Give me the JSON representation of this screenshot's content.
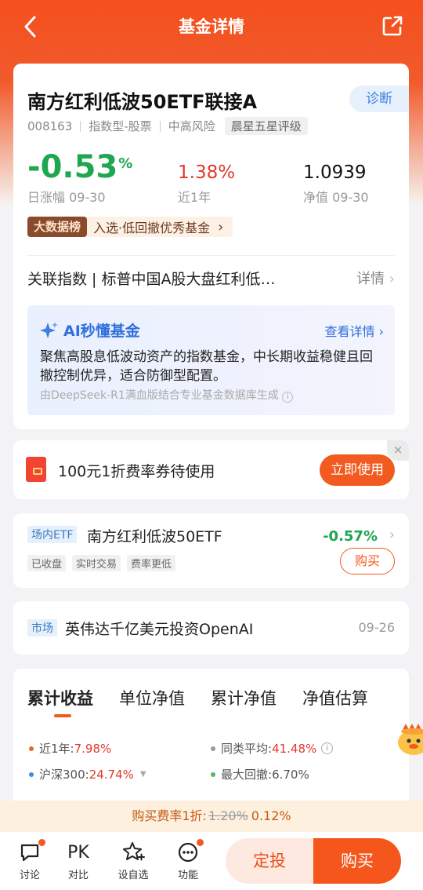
{
  "topbar": {
    "title": "基金详情"
  },
  "fund": {
    "name": "南方红利低波50ETF联接A",
    "diagnose": "诊断",
    "code": "008163",
    "type": "指数型-股票",
    "risk": "中高风险",
    "rating": "晨星五星评级",
    "daily_change": "-0.53",
    "daily_change_unit": "%",
    "daily_label": "日涨幅 09-30",
    "year_return": "1.38%",
    "year_label": "近1年",
    "nav": "1.0939",
    "nav_label": "净值 09-30",
    "rank_tag": "大数据榜",
    "rank_text": "入选·低回撤优秀基金",
    "index_label": "关联指数 | 标普中国A股大盘红利低…",
    "index_detail": "详情"
  },
  "ai": {
    "title": "AI秒懂基金",
    "more": "查看详情",
    "body": "聚焦高股息低波动资产的指数基金，中长期收益稳健且回撤控制优异，适合防御型配置。",
    "note": "由DeepSeek-R1满血版结合专业基金数据库生成"
  },
  "coupon": {
    "text": "100元1折费率券待使用",
    "button": "立即使用",
    "close": "×"
  },
  "etf": {
    "tag": "场内ETF",
    "name": "南方红利低波50ETF",
    "change": "-0.57%",
    "tags": [
      "已收盘",
      "实时交易",
      "费率更低"
    ],
    "buy": "购买"
  },
  "market": {
    "tag": "市场",
    "text": "英伟达千亿美元投资OpenAI",
    "date": "09-26"
  },
  "perf": {
    "tabs": [
      "累计收益",
      "单位净值",
      "累计净值",
      "净值估算"
    ],
    "legend": {
      "year_label": "近1年:",
      "year_value": "7.98%",
      "peer_label": "同类平均:",
      "peer_value": "41.48%",
      "hs300_label": "沪深300:",
      "hs300_value": "24.74%",
      "drawdown_label": "最大回撤:",
      "drawdown_value": "6.70%"
    }
  },
  "fee": {
    "prefix": "购买费率1折:",
    "old": "1.20%",
    "new": "0.12%"
  },
  "bottom": {
    "nav": [
      "讨论",
      "对比",
      "设自选",
      "功能"
    ],
    "pk": "PK",
    "dingtou": "定投",
    "buy": "购买"
  },
  "colors": {
    "brand": "#f25a1f",
    "up": "#e03a2b",
    "down": "#1ea650",
    "ai_blue": "#2f6edd"
  }
}
